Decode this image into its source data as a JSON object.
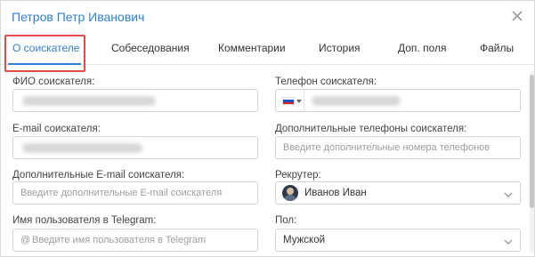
{
  "header": {
    "title": "Петров Петр Иванович"
  },
  "tabs": [
    {
      "label": "О соискателе",
      "active": true
    },
    {
      "label": "Собеседования"
    },
    {
      "label": "Комментарии"
    },
    {
      "label": "История"
    },
    {
      "label": "Доп. поля"
    },
    {
      "label": "Файлы"
    }
  ],
  "form": {
    "fio": {
      "label": "ФИО соискателя:",
      "value": ""
    },
    "phone": {
      "label": "Телефон соискателя:",
      "value": "",
      "flag": "ru-flag-icon"
    },
    "email": {
      "label": "E-mail соискателя:",
      "value": ""
    },
    "extra_phones": {
      "label": "Дополнительные телефоны соискателя:",
      "placeholder": "Введите дополнительные номера телефонов"
    },
    "extra_emails": {
      "label": "Дополнительные E-mail соискателя:",
      "placeholder": "Введите дополнительные E-mail соискателя"
    },
    "recruiter": {
      "label": "Рекрутер:",
      "value": "Иванов Иван"
    },
    "telegram": {
      "label": "Имя пользователя в Telegram:",
      "prefix": "@",
      "placeholder": "Введите имя пользователя в Telegram"
    },
    "gender": {
      "label": "Пол:",
      "value": "Мужской"
    }
  },
  "colors": {
    "accent": "#2f7fd4",
    "highlight": "#e04b4b",
    "border": "#d4d4d4",
    "placeholder": "#9d9d9d"
  }
}
